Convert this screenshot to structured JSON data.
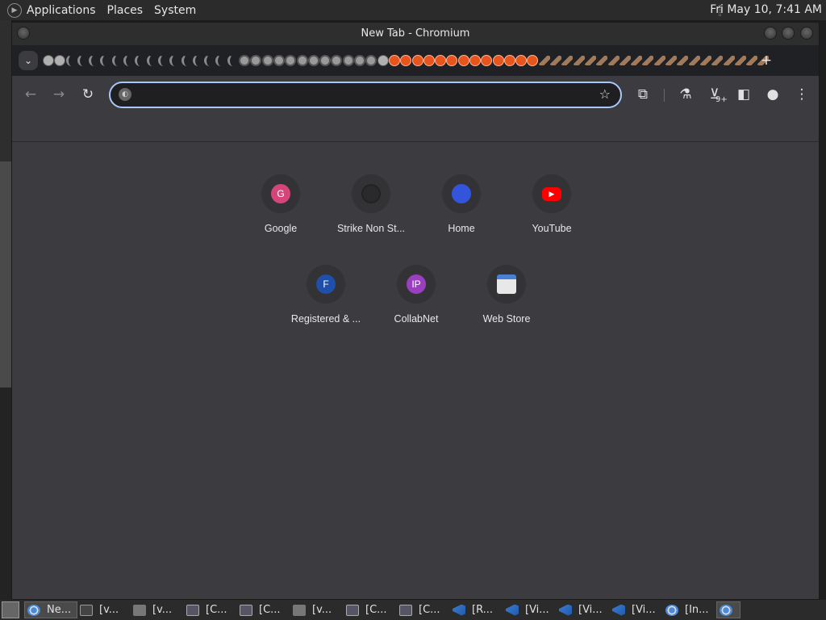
{
  "top_panel": {
    "menus": [
      "Applications",
      "Places",
      "System"
    ],
    "clock": "Fri May 10,  7:41 AM"
  },
  "window": {
    "title": "New Tab - Chromium"
  },
  "toolbar": {
    "omnibox_value": "",
    "downloads_badge": "9+"
  },
  "shortcuts": [
    {
      "label": "Google",
      "icon_letter": "G",
      "color": "#d6457a"
    },
    {
      "label": "Strike Non St...",
      "icon_letter": "",
      "color": "#2a2a2c"
    },
    {
      "label": "Home",
      "icon_letter": "",
      "color": "#3355dd"
    },
    {
      "label": "YouTube",
      "icon_letter": "",
      "color": "#ff0000"
    },
    {
      "label": "Registered & ...",
      "icon_letter": "F",
      "color": "#1f4fa8"
    },
    {
      "label": "CollabNet",
      "icon_letter": "IP",
      "color": "#9a3fbf"
    },
    {
      "label": "Web Store",
      "icon_letter": "",
      "color": "#4a7fd6"
    }
  ],
  "taskbar": {
    "items": [
      {
        "label": "Ne...",
        "icon": "chrome",
        "active": true
      },
      {
        "label": "[v...",
        "icon": "term",
        "active": false
      },
      {
        "label": "[v...",
        "icon": "folder",
        "active": false
      },
      {
        "label": "[C...",
        "icon": "monitor",
        "active": false
      },
      {
        "label": "[C...",
        "icon": "monitor",
        "active": false
      },
      {
        "label": "[v...",
        "icon": "folder",
        "active": false
      },
      {
        "label": "[C...",
        "icon": "monitor",
        "active": false
      },
      {
        "label": "[C...",
        "icon": "monitor",
        "active": false
      },
      {
        "label": "[R...",
        "icon": "vscode",
        "active": false
      },
      {
        "label": "[Vi...",
        "icon": "vscode",
        "active": false
      },
      {
        "label": "[Vi...",
        "icon": "vscode",
        "active": false
      },
      {
        "label": "[Vi...",
        "icon": "vscode",
        "active": false
      },
      {
        "label": "[In...",
        "icon": "chrome",
        "active": false
      }
    ]
  }
}
